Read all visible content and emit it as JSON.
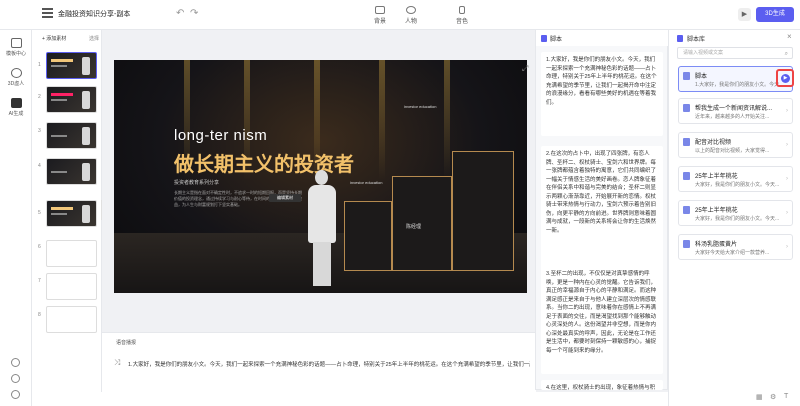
{
  "header": {
    "doc_title": "金融投资知识分享-副本",
    "tools": [
      {
        "label": "背景",
        "icon": "background-icon"
      },
      {
        "label": "人物",
        "icon": "person-icon"
      },
      {
        "label": "音色",
        "icon": "voice-icon"
      }
    ],
    "generate_label": "3D生成"
  },
  "leftnav": {
    "items": [
      {
        "label": "模板中心",
        "icon": "template-icon"
      },
      {
        "label": "3D虚人",
        "icon": "avatar-icon"
      },
      {
        "label": "AI生成",
        "icon": "ai-icon"
      }
    ]
  },
  "slides_panel": {
    "add_label": "+ 添加素材",
    "select_label": "选择",
    "slides": [
      "1",
      "2",
      "3",
      "4",
      "5",
      "6",
      "7",
      "8"
    ]
  },
  "canvas": {
    "title_en": "long-ter   nism",
    "title_cn": "做长期主义的投资者",
    "subtitle": "投资者教育系列分享",
    "body": "长期主义是指在面对不确定性时，不追求一时的短期回报，而是坚持长期价值的投资理念，通过持续学习与耐心等待，在时间的复利中获取稳健收益，为人生与财富规划打下坚实基础。",
    "badge": "编辑素材",
    "speaker_name": "陈经理",
    "investor_label_1": "investor education",
    "investor_label_2": "investor education"
  },
  "narration": {
    "label": "语音播报",
    "text": "1.大家好，我是你们的朋友小文。今天，我们一起来探索一个充满神秘色彩的话题——占卜命理，特别关于25年上半年的桃花运。在这个充满希望的季节里，让我们一起..."
  },
  "script": {
    "title": "脚本",
    "paragraphs": [
      "1.大家好，我是你们的朋友小文。今天，我们一起来探索一个充满神秘色彩的话题——占卜命理，特别关于25年上半年的桃花运。在这个充满希望的季节里，让我们一起揭开命中注定的浪漫缘分，看看有哪些美好的机遇在等着我们。",
      "2.在这次的占卜中，出现了四张牌，有恋人牌、圣杯二、权杖骑士、宝剑六和世界牌。每一张牌都蕴含着独特的寓意，它们共同编织了一幅关于情感生活的美好画卷。恋人牌象征着在伴侣关系中和谐与完美的结合；圣杯二则显示两颗心渐渐靠近，开始展开新的恋情。权杖骑士带来热情与行动力，宝剑六预示着告别旧伤，向更平静的方向前进。世界牌则意味着圆满与成就，一段新的关系将会让你的生活焕然一新。",
      "3.至杯二的出现，不仅仅是对真挚感情的呼唤，更是一种内在心灵的觉醒。它告诉我们，真正的幸福源自于内心的平静和满足。而这种满足感正是来自于与他人建立深层次的情感联系。当你二的出现，意味着你在感情上不再满足于表面的交往，而是渴望找到那个能够触动心灵深处的人。这份渴望并非空想，而是你内心深处最真实的呼声，因此，无论是在工作还是生活中，都要时刻保持一颗敏感的心，捕捉每一个可能到来的缘分。",
      "4.在这里，权杖骑士的出现，象征着热情与积极的行动。"
    ]
  },
  "library": {
    "title": "脚本库",
    "search_placeholder": "请输入视频或文案",
    "cards": [
      {
        "title": "脚本",
        "preview": "1.大家好，我是你们的朋友小文。今天..."
      },
      {
        "title": "帮我生成一个新闻资讯解说...",
        "preview": "近年来，越来越多的人开始关注..."
      },
      {
        "title": "配音对比视频",
        "preview": "以上的配音对比视频，大家觉得..."
      },
      {
        "title": "25年上半年桃花",
        "preview": "大家好，我是你们的朋友小文。今天..."
      },
      {
        "title": "25年上半年桃花",
        "preview": "大家好，我是你们的朋友小文。今天..."
      },
      {
        "title": "科汤乳脂蛋黄片",
        "preview": "大家好今天给大家介绍一款营养..."
      }
    ]
  }
}
